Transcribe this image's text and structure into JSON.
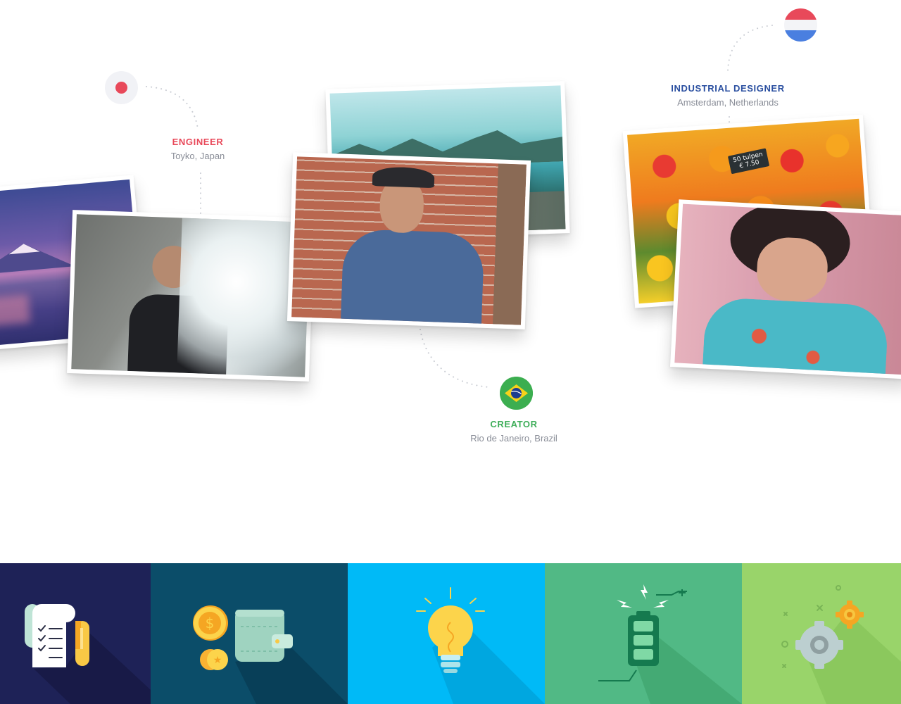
{
  "profiles": [
    {
      "role": "ENGINEER",
      "location": "Toyko, Japan",
      "flag": "japan-flag-icon"
    },
    {
      "role": "INDUSTRIAL DESIGNER",
      "location": "Amsterdam, Netherlands",
      "flag": "netherlands-flag-icon"
    },
    {
      "role": "CREATOR",
      "location": "Rio de Janeiro, Brazil",
      "flag": "brazil-flag-icon"
    }
  ],
  "colors": {
    "engineer_accent": "#e8495a",
    "designer_accent": "#2a4fa0",
    "creator_accent": "#3fae5a",
    "tile_docs": "#1e2257",
    "tile_money": "#0b4d69",
    "tile_idea": "#00baf7",
    "tile_energy": "#51b985",
    "tile_settings": "#99d46a"
  },
  "photos": {
    "tulips_sign_line1": "50 tulpen",
    "tulips_sign_line2": "€ 7.50"
  },
  "feature_tiles": [
    {
      "icon": "document-checklist-icon"
    },
    {
      "icon": "coins-wallet-icon"
    },
    {
      "icon": "lightbulb-icon"
    },
    {
      "icon": "battery-charging-icon"
    },
    {
      "icon": "gears-settings-icon"
    }
  ]
}
